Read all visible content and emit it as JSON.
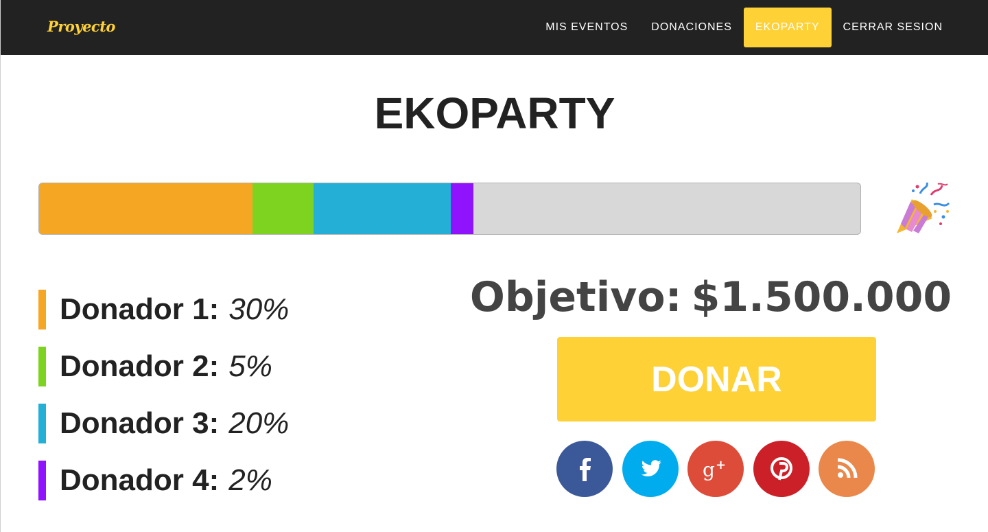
{
  "navbar": {
    "brand": "Proyecto",
    "items": [
      {
        "label": "MIS EVENTOS",
        "active": false
      },
      {
        "label": "DONACIONES",
        "active": false
      },
      {
        "label": "EKOPARTY",
        "active": true
      },
      {
        "label": "CERRAR SESION",
        "active": false
      }
    ],
    "accent_color": "#fed136",
    "background_color": "#222222"
  },
  "event": {
    "title": "EKOPARTY",
    "goal_label": "Objetivo:",
    "goal_value": "$1.500.000",
    "donate_label": "DONAR"
  },
  "progress": {
    "segments": [
      {
        "donor": "Donador 1",
        "fraction": 0.26,
        "color": "#f5a623"
      },
      {
        "donor": "Donador 2",
        "fraction": 0.074,
        "color": "#7ed321"
      },
      {
        "donor": "Donador 3",
        "fraction": 0.167,
        "color": "#23afd6"
      },
      {
        "donor": "Donador 4",
        "fraction": 0.028,
        "color": "#9013fe"
      }
    ],
    "track_color": "#d8d8d8",
    "icon": "party-popper-icon"
  },
  "donors": [
    {
      "name": "Donador 1",
      "percent": "30%",
      "color": "#f5a623"
    },
    {
      "name": "Donador 2",
      "percent": "5%",
      "color": "#7ed321"
    },
    {
      "name": "Donador 3",
      "percent": "20%",
      "color": "#23afd6"
    },
    {
      "name": "Donador 4",
      "percent": "2%",
      "color": "#9013fe"
    }
  ],
  "social": [
    {
      "icon": "facebook-icon",
      "color": "#3b5998"
    },
    {
      "icon": "twitter-icon",
      "color": "#00aced"
    },
    {
      "icon": "google-plus-icon",
      "color": "#dd4b39"
    },
    {
      "icon": "pinterest-icon",
      "color": "#cb2027"
    },
    {
      "icon": "rss-icon",
      "color": "#e9884a"
    }
  ]
}
